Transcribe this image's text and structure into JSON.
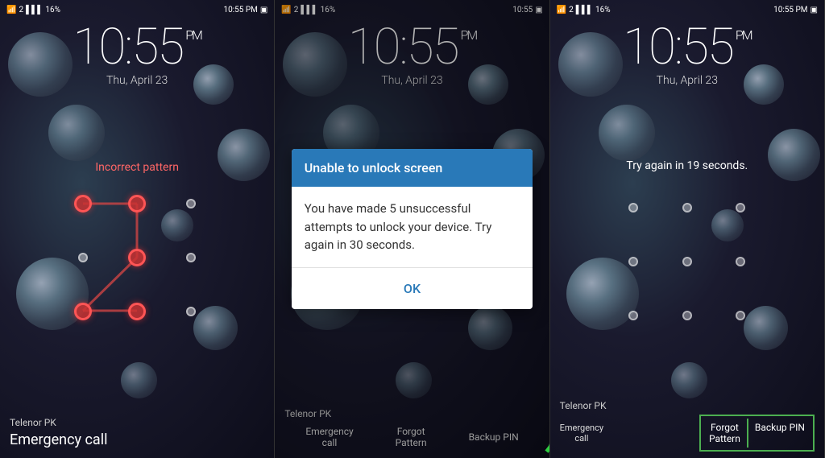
{
  "panel1": {
    "time": "10:55",
    "ampm": "PM",
    "date": "Thu, April 23",
    "incorrect_text": "Incorrect pattern",
    "carrier": "Telenor PK",
    "emergency_label": "Emergency call",
    "status": {
      "wifi": "▲",
      "signal": "2",
      "bars": "▌▌▌",
      "battery": "16%",
      "time_right": "10:55 PM",
      "photo_icon": "▣"
    }
  },
  "panel2": {
    "time": "10:55",
    "ampm": "PM",
    "date": "Thu, April 23",
    "carrier": "Telenor PK",
    "dialog": {
      "title": "Unable to unlock screen",
      "body": "You have made 5 unsuccessful attempts to unlock your device. Try again in 30 seconds.",
      "ok_label": "OK"
    },
    "bottom_buttons": [
      "Emergency call",
      "Forgot Pattern",
      "Backup PIN"
    ]
  },
  "panel3": {
    "time": "10:55",
    "ampm": "PM",
    "date": "Thu, April 23",
    "try_again_text": "Try again in 19 seconds.",
    "carrier": "Telenor PK",
    "bottom_buttons": {
      "emergency": "Emergency call",
      "forgot": "Forgot Pattern",
      "backup": "Backup PIN"
    },
    "highlight_label": "Forgot Backup PIN Pattern"
  }
}
